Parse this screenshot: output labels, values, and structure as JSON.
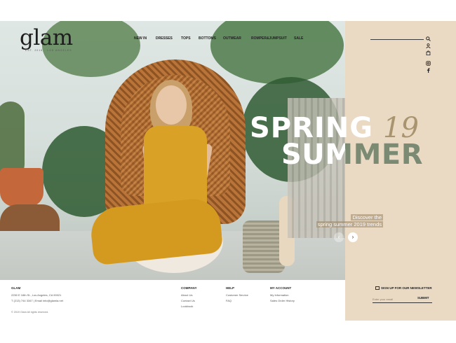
{
  "brand": {
    "logo": "glam",
    "tagline": "EST. 2016 · LOS ANGELES"
  },
  "nav": {
    "items": [
      "NEW IN",
      "DRESSES",
      "TOPS",
      "BOTTOMS",
      "OUTWEAR",
      "ROMPER&JUMPSUIT",
      "SALE"
    ]
  },
  "icons": [
    "search-icon",
    "user-icon",
    "bag-icon",
    "instagram-icon",
    "facebook-icon"
  ],
  "hero": {
    "line1": "SPRING",
    "year": "19",
    "line2": "SUMMER",
    "cta_line1": "Discover the",
    "cta_line2": "spring summer 2019 trends",
    "prev": "‹",
    "next": "›"
  },
  "footer": {
    "brand": "GLAM",
    "address": "2250 E 16th St., Los Angeles, CA 90021",
    "contact": "T (213) 744 3347 | Email info@glamla.net",
    "copyright": "© 2019 Glam All rights reserved.",
    "company": {
      "title": "COMPANY",
      "links": [
        "About Us",
        "Contact Us",
        "Lookbook"
      ]
    },
    "help": {
      "title": "HELP",
      "links": [
        "Customer Service",
        "FAQ"
      ]
    },
    "account": {
      "title": "MY ACCOUNT",
      "links": [
        "My Information",
        "Sales Order History"
      ]
    },
    "newsletter": {
      "title": "SIGN UP FOR OUR NEWSLETTER",
      "placeholder": "Enter your email",
      "submit": "SUBMIT"
    }
  },
  "colors": {
    "panel": "#ead9c3",
    "accent_green": "#7b8a72",
    "accent_gold": "#a8946e"
  }
}
